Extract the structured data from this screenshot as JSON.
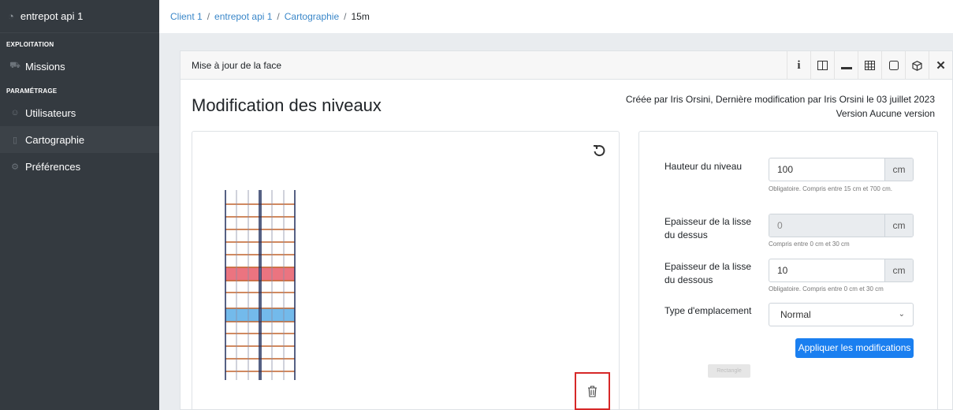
{
  "sidebar": {
    "brand": "entrepot api 1",
    "sections": [
      {
        "title": "EXPLOITATION",
        "items": [
          {
            "label": "Missions",
            "icon": "truck-icon"
          }
        ]
      },
      {
        "title": "PARAMÉTRAGE",
        "items": [
          {
            "label": "Utilisateurs",
            "icon": "users-icon"
          },
          {
            "label": "Cartographie",
            "icon": "map-icon",
            "active": true
          },
          {
            "label": "Préférences",
            "icon": "gear-icon"
          }
        ]
      }
    ]
  },
  "breadcrumb": [
    "Client 1",
    "entrepot api 1",
    "Cartographie",
    "15m"
  ],
  "card": {
    "header": "Mise à jour de la face",
    "tools": [
      "info-icon",
      "columns-icon",
      "horizontal-bar-icon",
      "grid-icon",
      "square-icon",
      "cube-icon",
      "close-icon"
    ]
  },
  "page": {
    "title": "Modification des niveaux",
    "meta_line1": "Créée par Iris Orsini, Dernière modification par Iris Orsini le 03 juillet 2023",
    "meta_line2": "Version Aucune version"
  },
  "form": {
    "height": {
      "label": "Hauteur du niveau",
      "value": "100",
      "unit": "cm",
      "help": "Obligatoire. Compris entre 15 cm et 700 cm."
    },
    "top": {
      "label": "Epaisseur de la lisse du dessus",
      "value": "0",
      "unit": "cm",
      "help": "Compris entre 0 cm et 30 cm"
    },
    "bottom": {
      "label": "Epaisseur de la lisse du dessous",
      "value": "10",
      "unit": "cm",
      "help": "Obligatoire. Compris entre 0 cm et 30 cm"
    },
    "type": {
      "label": "Type d'emplacement",
      "value": "Normal"
    },
    "apply_label": "Appliquer les modifications",
    "ghost_label": "Rectangle"
  },
  "colors": {
    "accent": "#1a7ff0",
    "sidebar": "#343a40",
    "beam": "#c0622b",
    "upright": "#1f2d5c",
    "highlight_red": "#e85c6a",
    "highlight_blue": "#5aaee8",
    "delete_frame": "#d62828"
  }
}
